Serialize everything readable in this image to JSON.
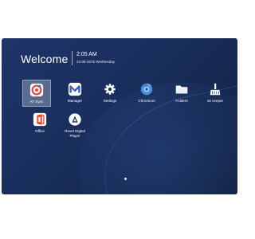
{
  "header": {
    "welcome": "Welcome",
    "time": "2:05 AM",
    "date": "23-05-2075 Wednesday"
  },
  "apps": [
    {
      "label": "AT Sync",
      "icon": "at-sync-icon",
      "selected": true
    },
    {
      "label": "Manager",
      "icon": "manager-icon",
      "selected": false
    },
    {
      "label": "Settings",
      "icon": "gear-icon",
      "selected": false
    },
    {
      "label": "Chromium",
      "icon": "chromium-icon",
      "selected": false
    },
    {
      "label": "Folders",
      "icon": "folder-icon",
      "selected": false
    },
    {
      "label": "x5 veeper",
      "icon": "broom-icon",
      "selected": false
    },
    {
      "label": "Office",
      "icon": "office-icon",
      "selected": false
    },
    {
      "label_line1": "Revel Digital",
      "label_line2": "Player",
      "icon": "revel-digital-icon",
      "selected": false
    }
  ],
  "colors": {
    "background": "#1a2f5e",
    "text": "#ffffff",
    "office_red": "#e8462c",
    "manager_blue": "#1f62d6",
    "at_sync_red": "#e8413e"
  }
}
